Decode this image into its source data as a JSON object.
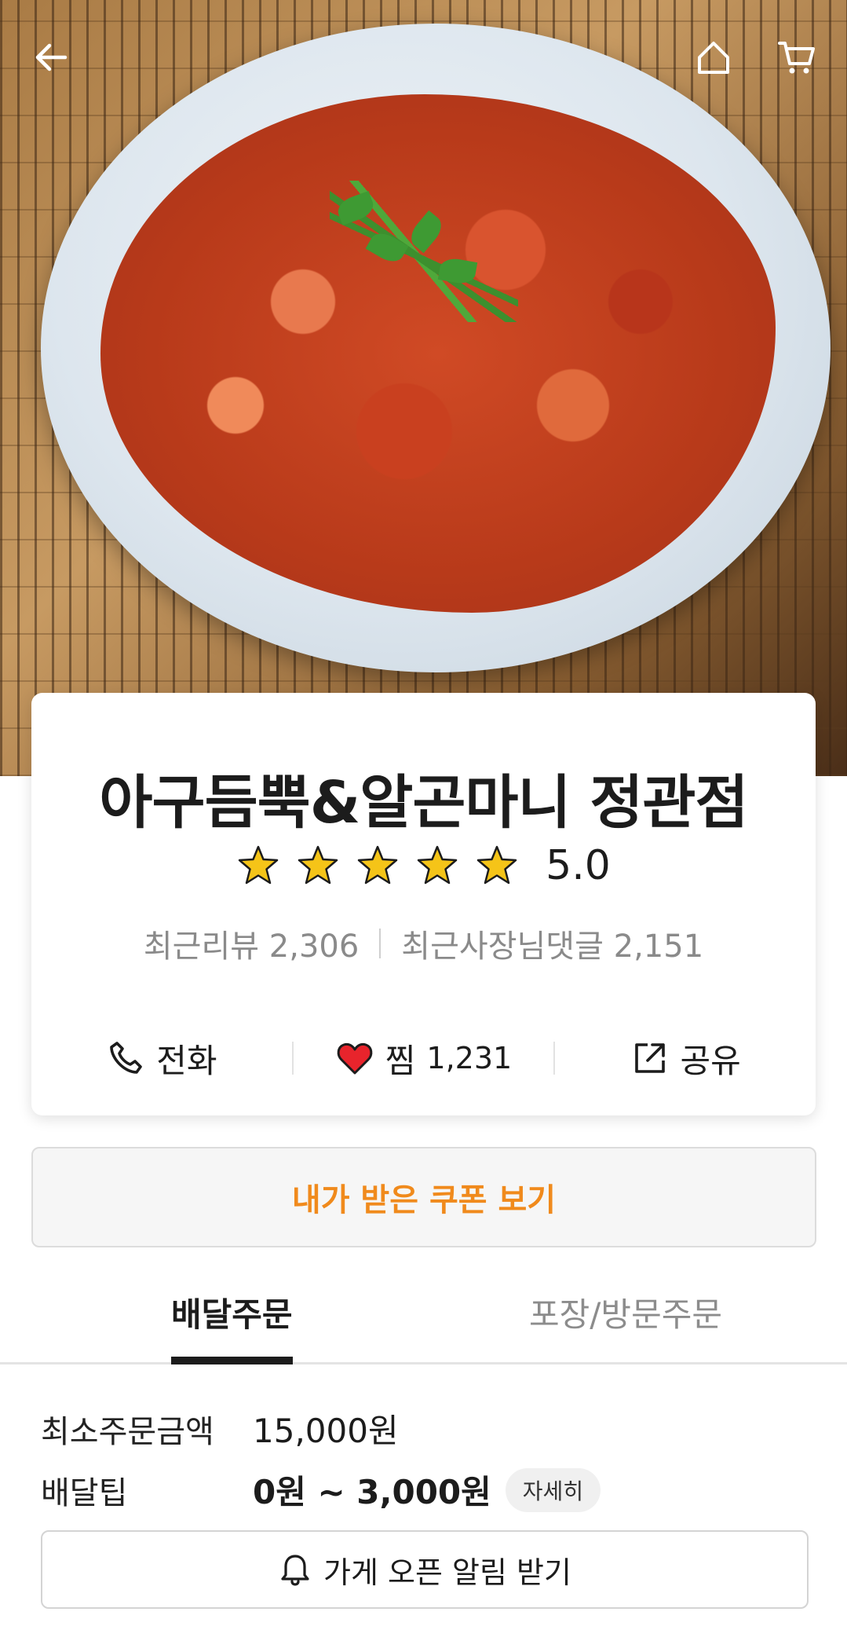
{
  "hero": {
    "image_alt": "",
    "back_icon": "arrow-left-icon",
    "home_icon": "home-icon",
    "cart_icon": "cart-icon"
  },
  "store": {
    "name": "아구듬뿍&알곤마니 정관점",
    "rating": "5.0",
    "stars": 5,
    "recent_reviews_label": "최근리뷰",
    "recent_reviews_count": "2,306",
    "owner_replies_label": "최근사장님댓글",
    "owner_replies_count": "2,151"
  },
  "actions": {
    "call_label": "전화",
    "like_label": "찜",
    "like_count": "1,231",
    "share_label": "공유"
  },
  "coupon": {
    "label": "내가 받은 쿠폰 보기"
  },
  "tabs": {
    "delivery": "배달주문",
    "pickup": "포장/방문주문"
  },
  "info": {
    "min_order_label": "최소주문금액",
    "min_order_value": "15,000원",
    "delivery_tip_label": "배달팁",
    "delivery_tip_value": "0원 ~ 3,000원",
    "detail_label": "자세히"
  },
  "alarm": {
    "label": "가게 오픈 알림 받기"
  },
  "colors": {
    "accent_orange": "#f08a1c",
    "heart_red": "#e8242c",
    "star_gold": "#f5c418"
  }
}
